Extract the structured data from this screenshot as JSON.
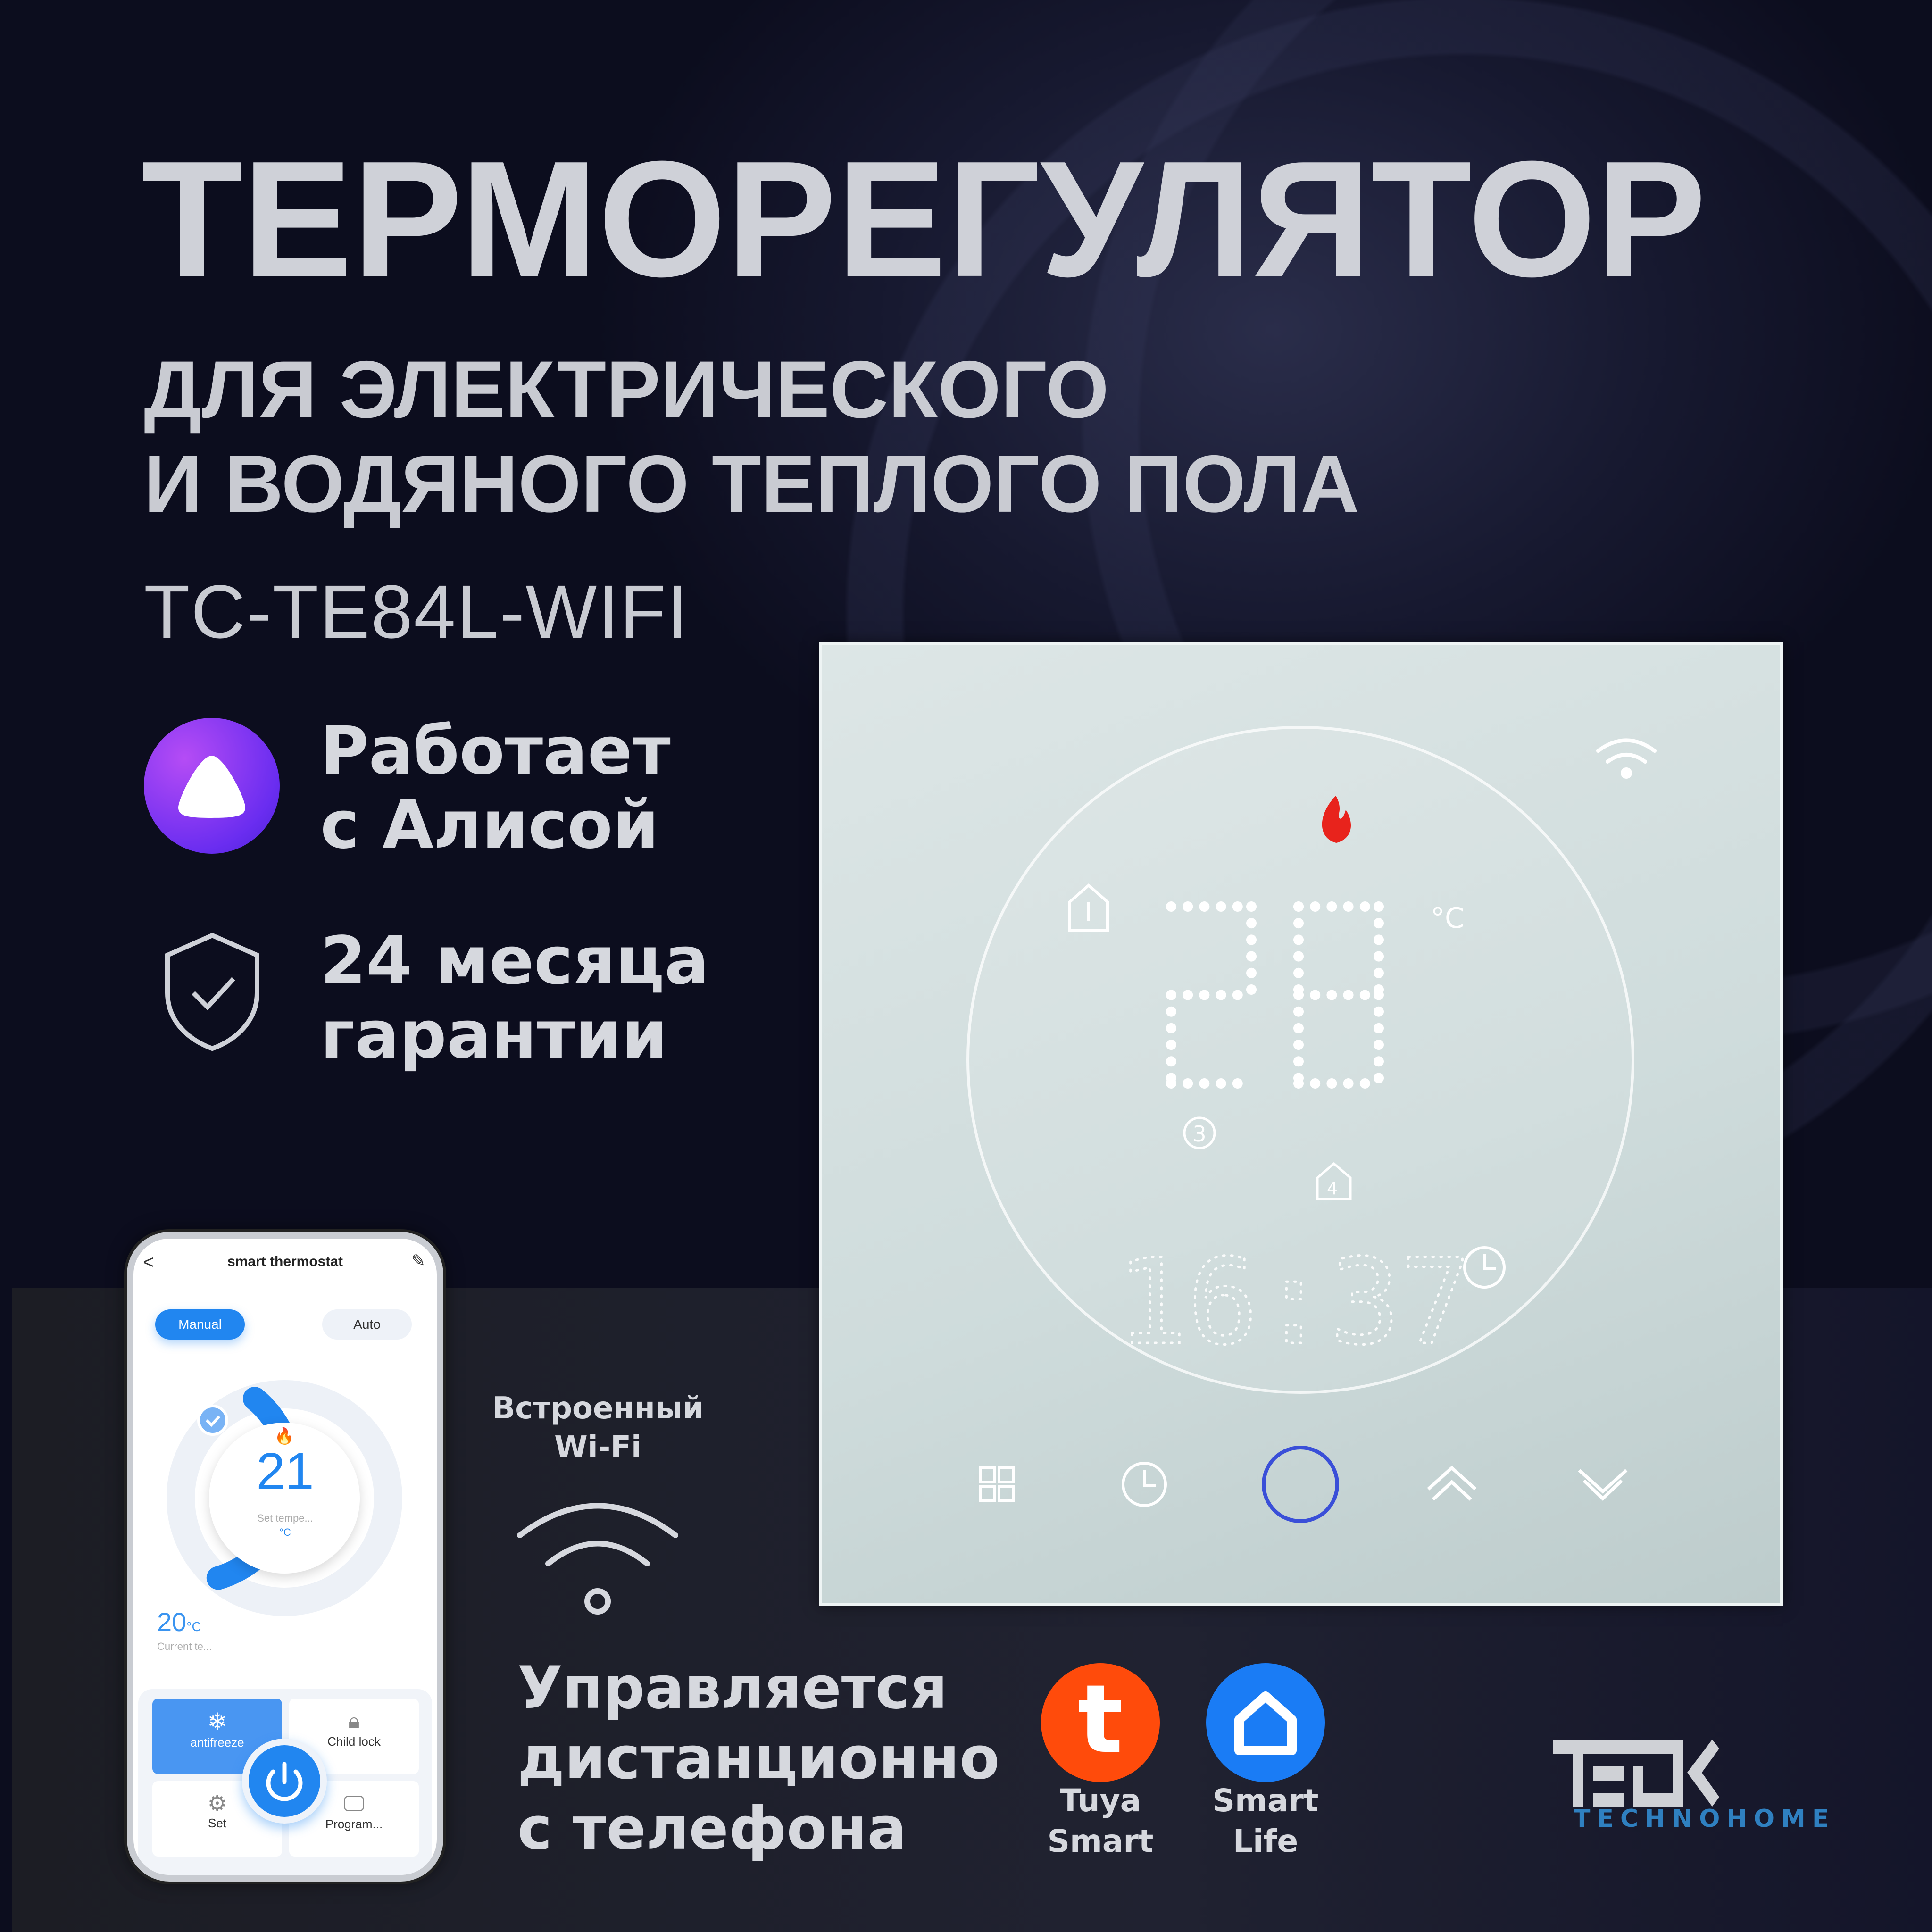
{
  "headline": {
    "title": "ТЕРМОРЕГУЛЯТОР",
    "subtitle_line1": "ДЛЯ ЭЛЕКТРИЧЕСКОГО",
    "subtitle_line2": "И ВОДЯНОГО ТЕПЛОГО ПОЛА",
    "model": "TC-TE84L-WIFI"
  },
  "features": {
    "alice_line1": "Работает",
    "alice_line2": "с Алисой",
    "warranty_line1": "24 месяца",
    "warranty_line2": "гарантии"
  },
  "wifi": {
    "line1": "Встроенный",
    "line2": "Wi-Fi"
  },
  "remote": {
    "line1": "Управляется",
    "line2": "дистанционно",
    "line3": "с телефона"
  },
  "apps": [
    {
      "name_line1": "Tuya",
      "name_line2": "Smart",
      "color": "#ff4b0b"
    },
    {
      "name_line1": "Smart",
      "name_line2": "Life",
      "color": "#1a7cf5"
    }
  ],
  "brand": {
    "logo": "TECK",
    "tagline": "TECHNOHOME",
    "tagline_color": "#2f80c0"
  },
  "thermostat": {
    "temperature": "28",
    "unit": "°C",
    "time": "16:37",
    "program_number": "3",
    "period": "4",
    "flame_color": "#e8231c",
    "power_ring_color": "#3a4fd8"
  },
  "app": {
    "title": "smart thermostat",
    "mode_manual": "Manual",
    "mode_auto": "Auto",
    "set_temp": "21",
    "set_label": "Set tempe...",
    "set_unit": "°C",
    "current_temp": "20",
    "current_unit": "°C",
    "current_label": "Current te...",
    "tiles": [
      "antifreeze",
      "Child lock",
      "Set",
      "Program..."
    ],
    "accent": "#2186f0",
    "set_fraction": 0.55
  }
}
